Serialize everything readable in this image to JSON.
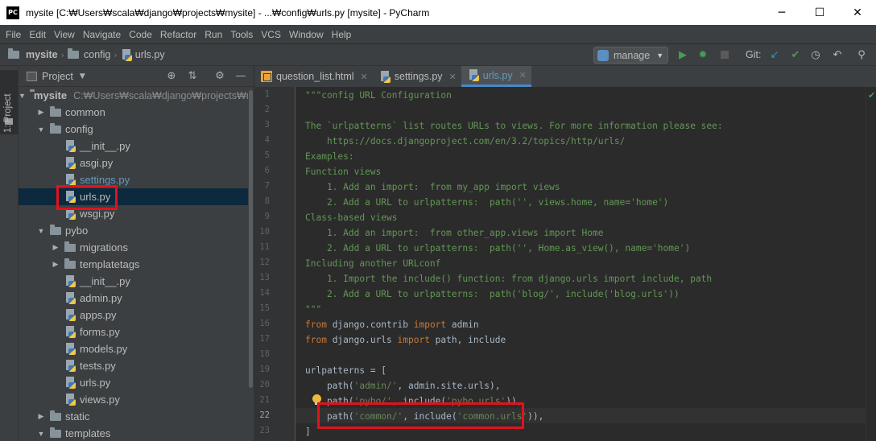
{
  "window": {
    "app_icon_text": "PC",
    "title": "mysite [C:₩Users₩scala₩django₩projects₩mysite] - ...₩config₩urls.py [mysite] - PyCharm",
    "minimize": "─",
    "maximize": "☐",
    "close": "✕"
  },
  "menu": [
    "File",
    "Edit",
    "View",
    "Navigate",
    "Code",
    "Refactor",
    "Run",
    "Tools",
    "VCS",
    "Window",
    "Help"
  ],
  "breadcrumb": {
    "root": "mysite",
    "folder": "config",
    "file": "urls.py"
  },
  "toolbar": {
    "run_config": "manage",
    "git_label": "Git:"
  },
  "toolwindow": {
    "label": "1: Project"
  },
  "project_panel": {
    "title": "Project",
    "tree": [
      {
        "name": "mysite",
        "path": "C:₩Users₩scala₩django₩projects₩mys",
        "type": "folder",
        "arrow": "▼",
        "bold": true
      },
      {
        "name": "common",
        "type": "folder",
        "arrow": "▶"
      },
      {
        "name": "config",
        "type": "folder",
        "arrow": "▼"
      },
      {
        "name": "__init__.py",
        "type": "py"
      },
      {
        "name": "asgi.py",
        "type": "py"
      },
      {
        "name": "settings.py",
        "type": "py",
        "color": "#6897bb"
      },
      {
        "name": "urls.py",
        "type": "py",
        "selected": true
      },
      {
        "name": "wsgi.py",
        "type": "py"
      },
      {
        "name": "pybo",
        "type": "folder",
        "arrow": "▼"
      },
      {
        "name": "migrations",
        "type": "folder",
        "arrow": "▶"
      },
      {
        "name": "templatetags",
        "type": "folder",
        "arrow": "▶"
      },
      {
        "name": "__init__.py",
        "type": "py"
      },
      {
        "name": "admin.py",
        "type": "py"
      },
      {
        "name": "apps.py",
        "type": "py"
      },
      {
        "name": "forms.py",
        "type": "py"
      },
      {
        "name": "models.py",
        "type": "py"
      },
      {
        "name": "tests.py",
        "type": "py"
      },
      {
        "name": "urls.py",
        "type": "py"
      },
      {
        "name": "views.py",
        "type": "py"
      },
      {
        "name": "static",
        "type": "folder",
        "arrow": "▶"
      },
      {
        "name": "templates",
        "type": "folder",
        "arrow": "▼"
      }
    ]
  },
  "tabs": [
    {
      "label": "question_list.html",
      "icon": "html-file-icon",
      "active": false
    },
    {
      "label": "settings.py",
      "icon": "python-file-icon",
      "active": false
    },
    {
      "label": "urls.py",
      "icon": "python-file-icon",
      "active": true
    }
  ],
  "editor": {
    "current_line": 22,
    "line_numbers": [
      1,
      2,
      3,
      4,
      5,
      6,
      7,
      8,
      9,
      10,
      11,
      12,
      13,
      14,
      15,
      16,
      17,
      18,
      19,
      20,
      21,
      22,
      23
    ],
    "lines": [
      [
        {
          "c": "doc",
          "t": "\"\"\"config URL Configuration"
        }
      ],
      [],
      [
        {
          "c": "doc",
          "t": "The `urlpatterns` list routes URLs to views. For more information please see:"
        }
      ],
      [
        {
          "c": "doc",
          "t": "    https://docs.djangoproject.com/en/3.2/topics/http/urls/"
        }
      ],
      [
        {
          "c": "doc",
          "t": "Examples:"
        }
      ],
      [
        {
          "c": "doc",
          "t": "Function views"
        }
      ],
      [
        {
          "c": "doc",
          "t": "    1. Add an import:  from my_app import views"
        }
      ],
      [
        {
          "c": "doc",
          "t": "    2. Add a URL to urlpatterns:  path('', views.home, name='home')"
        }
      ],
      [
        {
          "c": "doc",
          "t": "Class-based views"
        }
      ],
      [
        {
          "c": "doc",
          "t": "    1. Add an import:  from other_app.views import Home"
        }
      ],
      [
        {
          "c": "doc",
          "t": "    2. Add a URL to urlpatterns:  path('', Home.as_view(), name='home')"
        }
      ],
      [
        {
          "c": "doc",
          "t": "Including another URLconf"
        }
      ],
      [
        {
          "c": "doc",
          "t": "    1. Import the include() function: from django.urls import include, path"
        }
      ],
      [
        {
          "c": "doc",
          "t": "    2. Add a URL to urlpatterns:  path('blog/', include('blog.urls'))"
        }
      ],
      [
        {
          "c": "doc",
          "t": "\"\"\""
        }
      ],
      [
        {
          "c": "kw",
          "t": "from "
        },
        {
          "c": "",
          "t": "django.contrib "
        },
        {
          "c": "kw",
          "t": "import "
        },
        {
          "c": "",
          "t": "admin"
        }
      ],
      [
        {
          "c": "kw",
          "t": "from "
        },
        {
          "c": "",
          "t": "django.urls "
        },
        {
          "c": "kw",
          "t": "import "
        },
        {
          "c": "",
          "t": "path, include"
        }
      ],
      [],
      [
        {
          "c": "",
          "t": "urlpatterns = ["
        }
      ],
      [
        {
          "c": "",
          "t": "    path("
        },
        {
          "c": "str",
          "t": "'admin/'"
        },
        {
          "c": "",
          "t": ", admin.site.urls),"
        }
      ],
      [
        {
          "c": "",
          "t": "    path("
        },
        {
          "c": "str",
          "t": "'pybo/'"
        },
        {
          "c": "",
          "t": ", include("
        },
        {
          "c": "str",
          "t": "'pybo.urls'"
        },
        {
          "c": "",
          "t": ")),"
        }
      ],
      [
        {
          "c": "",
          "t": "    path("
        },
        {
          "c": "str",
          "t": "'common/'"
        },
        {
          "c": "",
          "t": ", include("
        },
        {
          "c": "str",
          "t": "'common.urls'"
        },
        {
          "c": "",
          "t": ")),"
        }
      ],
      [
        {
          "c": "",
          "t": "]"
        }
      ]
    ]
  },
  "colors": {
    "highlight_box": "#e0131d",
    "selection": "#0d293e",
    "accent_tab": "#4a88c7"
  }
}
